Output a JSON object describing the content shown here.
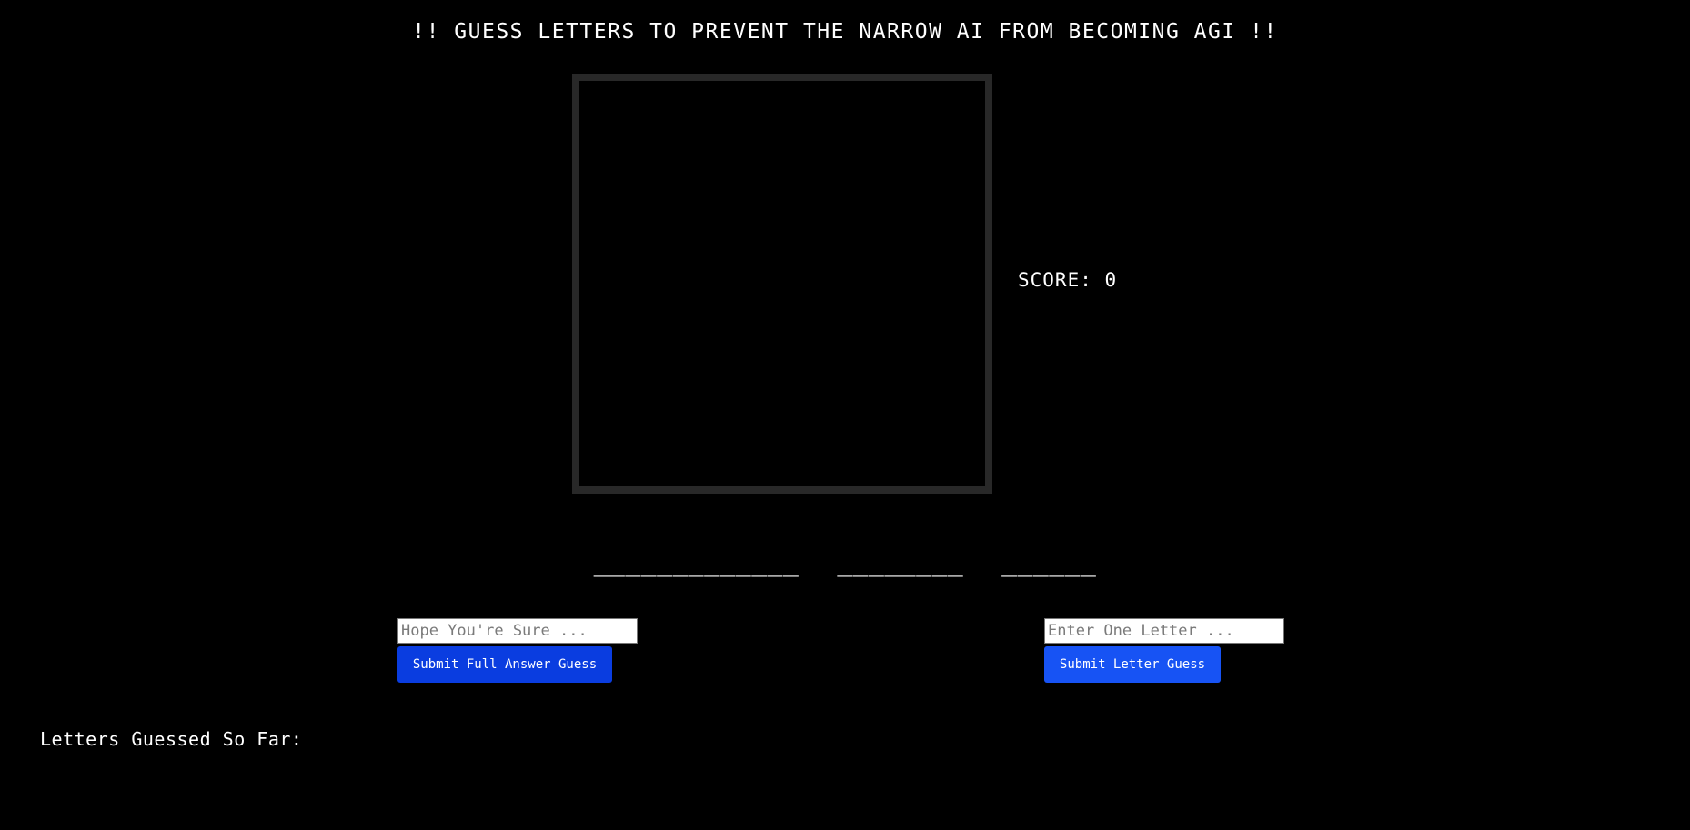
{
  "header": {
    "title": "!! GUESS LETTERS TO PREVENT THE NARROW AI FROM BECOMING AGI !!"
  },
  "game": {
    "score_label": "SCORE: 0",
    "score": 0,
    "word_blanks": [
      "_____________",
      "________",
      "______"
    ]
  },
  "full_guess": {
    "placeholder": "Hope You're Sure ...",
    "value": "",
    "button_label": "Submit Full Answer Guess"
  },
  "letter_guess": {
    "placeholder": "Enter One Letter ...",
    "value": "",
    "button_label": "Submit Letter Guess"
  },
  "letters_guessed": {
    "label": "Letters Guessed So Far:",
    "letters": ""
  },
  "colors": {
    "background": "#000000",
    "text": "#ffffff",
    "canvas_border": "#282828",
    "full_button": "#0a3de0",
    "letter_button": "#1753f4"
  }
}
